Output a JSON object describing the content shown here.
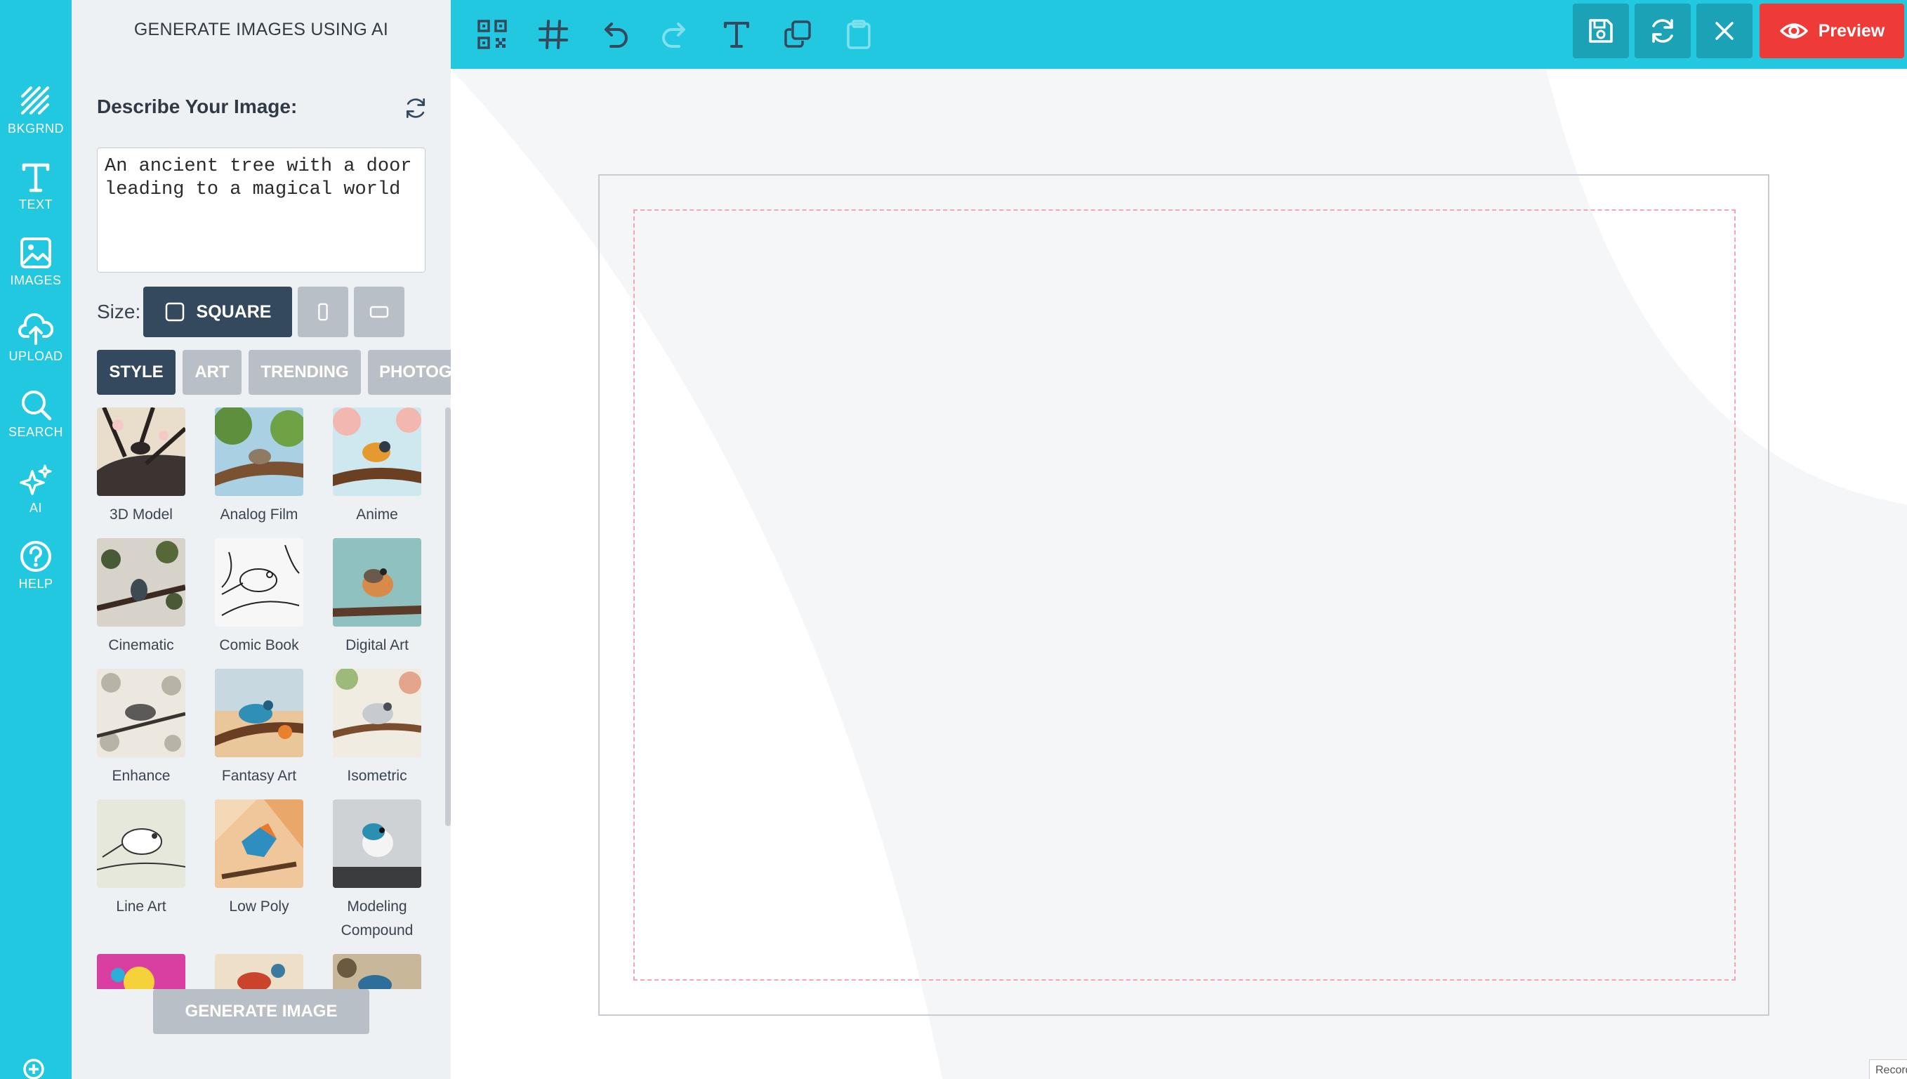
{
  "rail": {
    "items": [
      {
        "label": "BKGRND",
        "icon": "background-hatch-icon"
      },
      {
        "label": "TEXT",
        "icon": "text-icon"
      },
      {
        "label": "IMAGES",
        "icon": "image-icon"
      },
      {
        "label": "UPLOAD",
        "icon": "cloud-upload-icon"
      },
      {
        "label": "SEARCH",
        "icon": "search-icon"
      },
      {
        "label": "AI",
        "icon": "sparkles-icon"
      },
      {
        "label": "HELP",
        "icon": "help-icon"
      }
    ],
    "active": "AI",
    "zoom_icon": "zoom-in-icon"
  },
  "panel": {
    "title": "GENERATE IMAGES USING AI",
    "describe_label": "Describe Your Image:",
    "prompt_value": "An ancient tree with a door leading to a magical world",
    "size_label": "Size:",
    "size_options": {
      "square": "SQUARE"
    },
    "tabs": [
      "STYLE",
      "ART",
      "TRENDING",
      "PHOTOG"
    ],
    "active_tab": "STYLE",
    "styles": [
      "3D Model",
      "Analog Film",
      "Anime",
      "Cinematic",
      "Comic Book",
      "Digital Art",
      "Enhance",
      "Fantasy Art",
      "Isometric",
      "Line Art",
      "Low Poly",
      "Modeling Compound"
    ],
    "generate_label": "GENERATE IMAGE"
  },
  "toolbar": {
    "tools": [
      "qr-code-icon",
      "grid-icon",
      "undo-icon",
      "redo-icon",
      "text-icon",
      "duplicate-icon",
      "clipboard-icon"
    ],
    "preview_label": "Preview"
  },
  "workspace": {
    "corner_text": "Record"
  },
  "colors": {
    "accent": "#22c8e0",
    "panel_bg": "#eef1f4",
    "active_dark": "#34495e",
    "inactive": "#b8bfc7",
    "preview_red": "#ef3b37",
    "toolbar_btn": "#1ba2b6",
    "safe_zone": "#f4a6b4"
  }
}
